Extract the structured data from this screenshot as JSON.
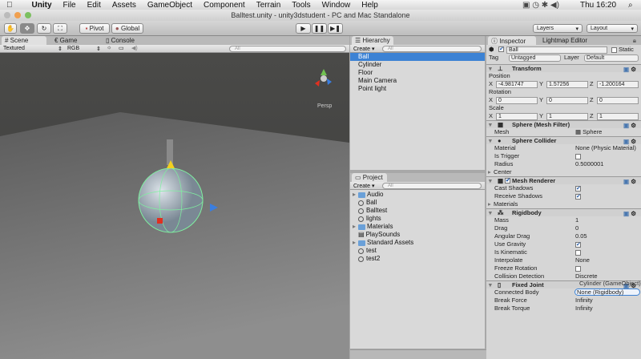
{
  "menubar": {
    "apple": "",
    "app": "Unity",
    "items": [
      "File",
      "Edit",
      "Assets",
      "GameObject",
      "Component",
      "Terrain",
      "Tools",
      "Window",
      "Help"
    ],
    "clock": "Thu 16:20"
  },
  "window": {
    "title": "Balltest.unity - unity3dstudent - PC and Mac Standalone"
  },
  "toolbar": {
    "pivot": "Pivot",
    "global": "Global",
    "layers": "Layers",
    "layout": "Layout"
  },
  "scene": {
    "tabs": [
      "Scene",
      "Game",
      "Console"
    ],
    "render_mode": "Textured",
    "channel": "RGB",
    "search_placeholder": "All",
    "persp": "Persp"
  },
  "hierarchy": {
    "title": "Hierarchy",
    "create": "Create",
    "search_placeholder": "All",
    "items": [
      "Ball",
      "Cylinder",
      "Floor",
      "Main Camera",
      "Point light"
    ],
    "selected": "Ball"
  },
  "project": {
    "title": "Project",
    "create": "Create",
    "search_placeholder": "All",
    "items": [
      {
        "name": "Audio",
        "type": "folder"
      },
      {
        "name": "Ball",
        "type": "prefab"
      },
      {
        "name": "Balltest",
        "type": "scene"
      },
      {
        "name": "lights",
        "type": "scene"
      },
      {
        "name": "Materials",
        "type": "folder"
      },
      {
        "name": "PlaySounds",
        "type": "script"
      },
      {
        "name": "Standard Assets",
        "type": "folder"
      },
      {
        "name": "test",
        "type": "scene"
      },
      {
        "name": "test2",
        "type": "scene"
      }
    ]
  },
  "inspector": {
    "tabs": [
      "Inspector",
      "Lightmap Editor"
    ],
    "object_name": "Ball",
    "static": "Static",
    "tag_label": "Tag",
    "tag": "Untagged",
    "layer_label": "Layer",
    "layer": "Default",
    "transform": {
      "title": "Transform",
      "position": "Position",
      "rotation": "Rotation",
      "scale": "Scale",
      "pos": [
        "-4.981747",
        "1.57256",
        "-1.200164"
      ],
      "rot": [
        "0",
        "0",
        "0"
      ],
      "scl": [
        "1",
        "1",
        "1"
      ],
      "axes": [
        "X",
        "Y",
        "Z"
      ]
    },
    "mesh_filter": {
      "title": "Sphere (Mesh Filter)",
      "mesh_label": "Mesh",
      "mesh": "Sphere"
    },
    "sphere_collider": {
      "title": "Sphere Collider",
      "material_label": "Material",
      "material": "None (Physic Material)",
      "is_trigger_label": "Is Trigger",
      "is_trigger": false,
      "radius_label": "Radius",
      "radius": "0.5000001",
      "center_label": "Center"
    },
    "mesh_renderer": {
      "title": "Mesh Renderer",
      "cast_label": "Cast Shadows",
      "cast": true,
      "receive_label": "Receive Shadows",
      "receive": true,
      "materials_label": "Materials"
    },
    "rigidbody": {
      "title": "Rigidbody",
      "mass_label": "Mass",
      "mass": "1",
      "drag_label": "Drag",
      "drag": "0",
      "angular_label": "Angular Drag",
      "angular": "0.05",
      "gravity_label": "Use Gravity",
      "gravity": true,
      "kinematic_label": "Is Kinematic",
      "kinematic": false,
      "interp_label": "Interpolate",
      "interp": "None",
      "freeze_label": "Freeze Rotation",
      "freeze": false,
      "collision_label": "Collision Detection",
      "collision": "Discrete"
    },
    "fixed_joint": {
      "title": "Fixed Joint",
      "drag_hint": "Cylinder (GameObject)",
      "connected_label": "Connected Body",
      "connected": "None (Rigidbody)",
      "force_label": "Break Force",
      "force": "Infinity",
      "torque_label": "Break Torque",
      "torque": "Infinity"
    }
  },
  "colors": {
    "selection": "#3c82d4",
    "panel": "#d9d9d9",
    "scene_bg": "#474747"
  }
}
